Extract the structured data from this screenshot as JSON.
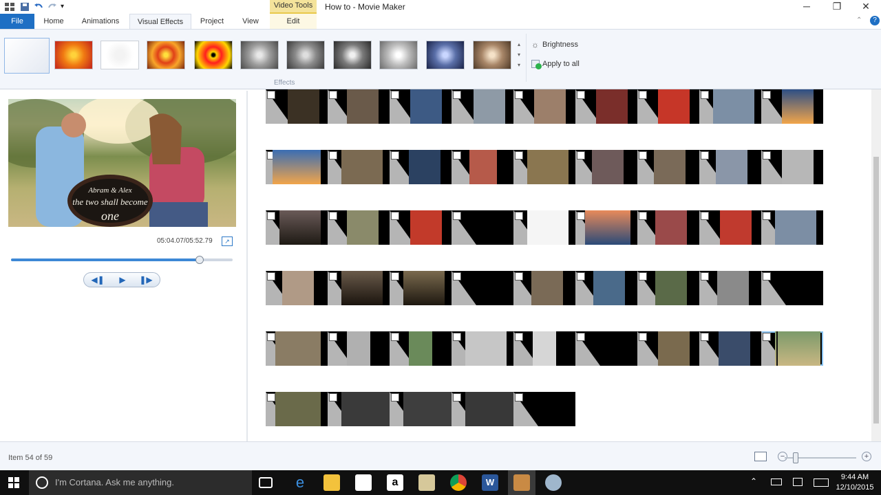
{
  "window": {
    "title": "How to - Movie Maker",
    "context_tab": "Video Tools"
  },
  "tabs": {
    "file": "File",
    "home": "Home",
    "animations": "Animations",
    "visual_effects": "Visual Effects",
    "project": "Project",
    "view": "View",
    "edit": "Edit"
  },
  "ribbon": {
    "group_label": "Effects",
    "brightness": "Brightness",
    "apply_to_all": "Apply to all"
  },
  "preview": {
    "time": "05:04.07/05:52.79",
    "progress": 0.85
  },
  "status": {
    "item_count": "Item 54 of 59"
  },
  "taskbar": {
    "cortana_placeholder": "I'm Cortana. Ask me anything.",
    "time": "9:44 AM",
    "date": "12/10/2015"
  },
  "colors": {
    "accent": "#1e6fc4",
    "context_tab": "#f4e39b"
  },
  "icons": [
    "windows-icon",
    "cortana-icon",
    "task-view-icon",
    "edge-icon",
    "file-explorer-icon",
    "store-icon",
    "amazon-icon",
    "chrome-icon",
    "word-icon",
    "movie-maker-icon"
  ]
}
